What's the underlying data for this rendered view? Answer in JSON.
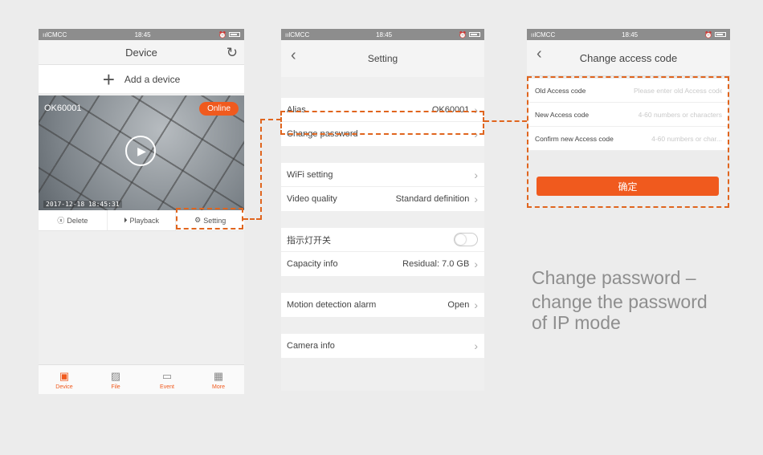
{
  "status": {
    "carrier": "CMCC",
    "signal": "📶",
    "time": "18:45",
    "icons": "⏰ ♡"
  },
  "phone1": {
    "title": "Device",
    "add_device": "Add a device",
    "camera": {
      "name": "OK60001",
      "status": "Online",
      "timestamp": "2017-12-18  18:45:31"
    },
    "actions": {
      "delete": "Delete",
      "playback": "Playback",
      "setting": "Setting"
    },
    "tabs": [
      {
        "label": "Device",
        "icon": "video-camera-icon"
      },
      {
        "label": "File",
        "icon": "image-icon"
      },
      {
        "label": "Event",
        "icon": "message-icon"
      },
      {
        "label": "More",
        "icon": "grid-icon"
      }
    ]
  },
  "phone2": {
    "title": "Setting",
    "alias": {
      "label": "Alias",
      "value": "OK60001"
    },
    "change_password": "Change password",
    "wifi": "WiFi setting",
    "video_quality": {
      "label": "Video quality",
      "value": "Standard definition"
    },
    "indicator": "指示灯开关",
    "capacity": {
      "label": "Capacity info",
      "value": "Residual:  7.0 GB"
    },
    "motion": {
      "label": "Motion detection alarm",
      "value": "Open"
    },
    "camera_info": "Camera info"
  },
  "phone3": {
    "title": "Change access code",
    "old": {
      "label": "Old Access code",
      "placeholder": "Please enter old Access code"
    },
    "new": {
      "label": "New Access code",
      "placeholder": "4-60 numbers or characters"
    },
    "confirm_new": {
      "label": "Confirm new Access code",
      "placeholder": "4-60 numbers or char..."
    },
    "confirm_button": "确定"
  },
  "caption": {
    "line1": "Change password –",
    "line2": "change the password",
    "line3": "of IP mode"
  },
  "colors": {
    "accent": "#f05a1e",
    "callout": "#e0651e"
  }
}
